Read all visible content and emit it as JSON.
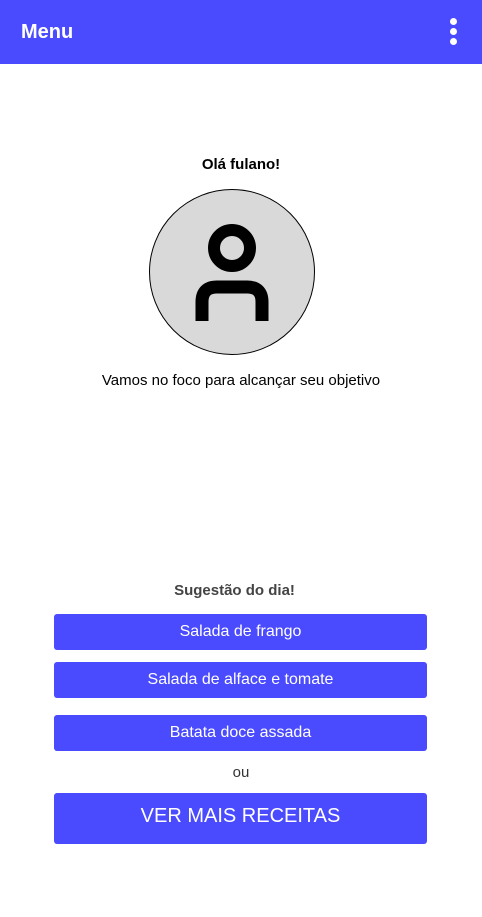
{
  "header": {
    "title": "Menu",
    "menu_icon": "more-vertical-icon"
  },
  "profile": {
    "greeting": "Olá fulano!",
    "avatar_icon": "user-icon",
    "motivation": "Vamos no foco para alcançar seu objetivo"
  },
  "suggestions": {
    "title": "Sugestão do dia!",
    "items": [
      {
        "label": "Salada de frango"
      },
      {
        "label": "Salada de alface e tomate"
      },
      {
        "label": "Batata doce assada"
      }
    ],
    "or_text": "ou",
    "more_label": "VER MAIS RECEITAS"
  },
  "colors": {
    "primary": "#4a4aff",
    "avatar_bg": "#d9d9d9",
    "text": "#000000"
  }
}
